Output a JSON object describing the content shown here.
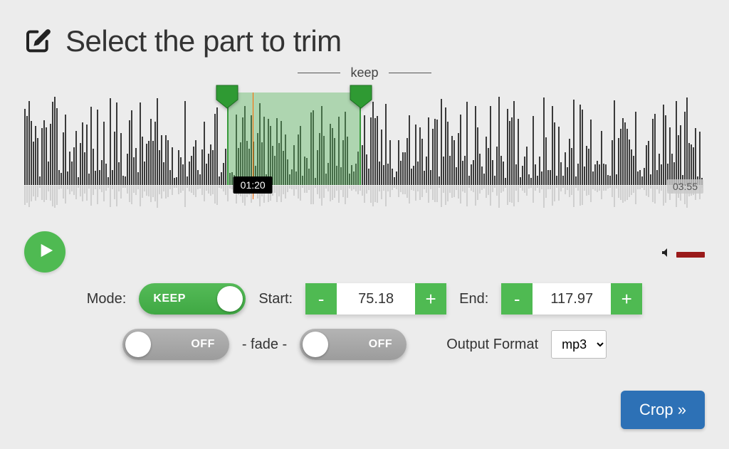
{
  "header": {
    "title": "Select the part to trim",
    "keep_label": "keep"
  },
  "waveform": {
    "playhead_time": "01:20",
    "total_time": "03:55",
    "selection_start_pct": 29.8,
    "selection_end_pct": 49.5,
    "playhead_pct": 33.6
  },
  "controls": {
    "mode_label": "Mode:",
    "mode_value": "KEEP",
    "start_label": "Start:",
    "start_value": "75.18",
    "end_label": "End:",
    "end_value": "117.97",
    "minus": "-",
    "plus": "+",
    "fade_label": "- fade -",
    "fade_in_value": "OFF",
    "fade_out_value": "OFF",
    "output_label": "Output Format",
    "output_selected": "mp3"
  },
  "buttons": {
    "crop": "Crop »"
  },
  "colors": {
    "accent_green": "#4fba52",
    "accent_blue": "#2d71b6"
  }
}
